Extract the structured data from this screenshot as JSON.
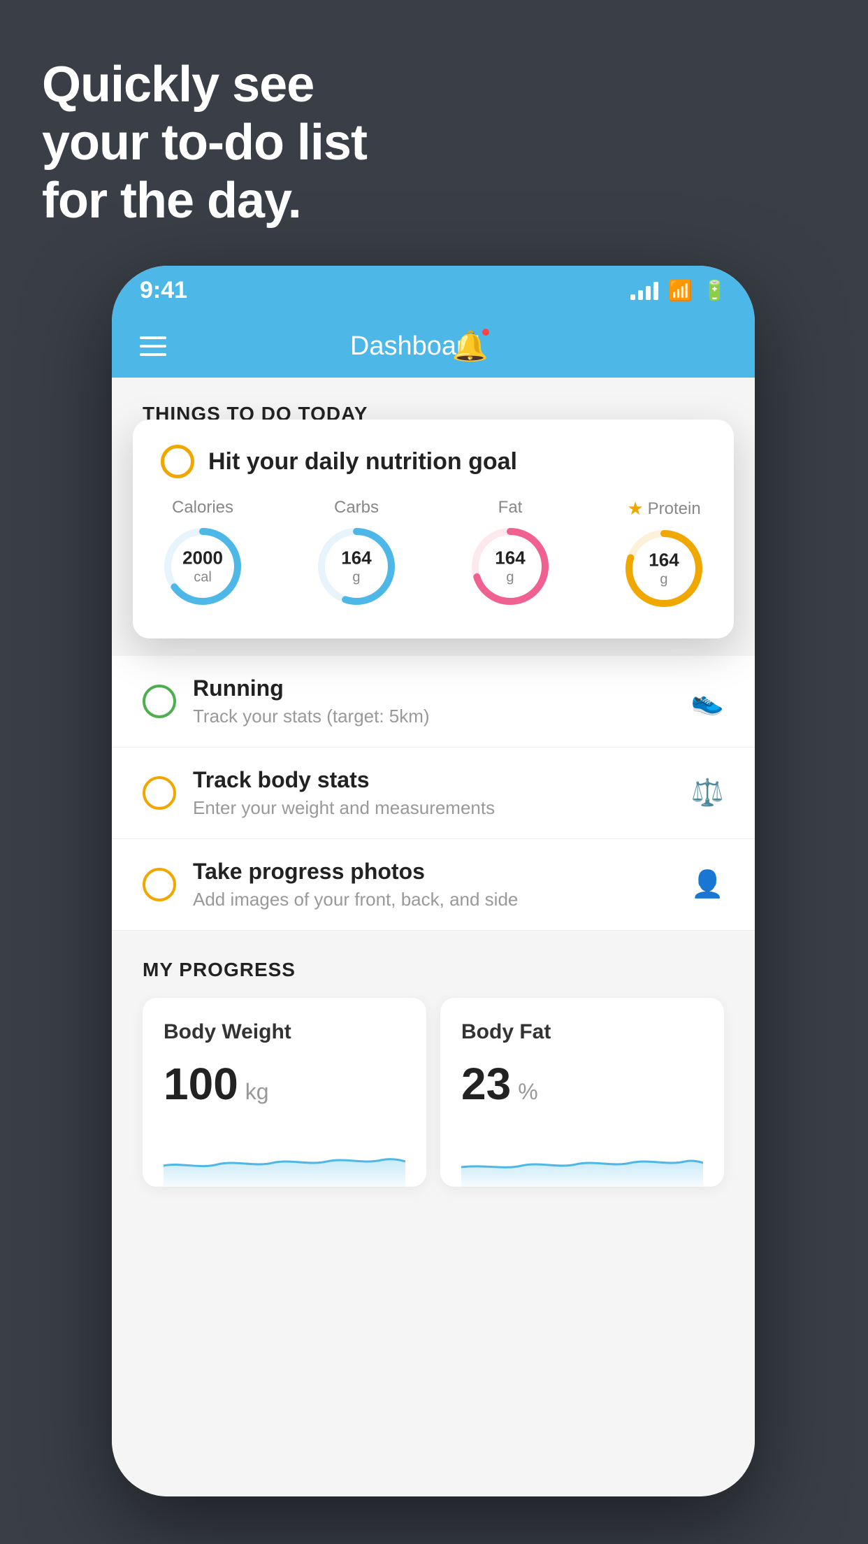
{
  "hero": {
    "line1": "Quickly see",
    "line2": "your to-do list",
    "line3": "for the day."
  },
  "phone": {
    "status_bar": {
      "time": "9:41",
      "signal": "signal",
      "wifi": "wifi",
      "battery": "battery"
    },
    "nav": {
      "title": "Dashboard",
      "hamburger_label": "menu",
      "bell_label": "notifications"
    },
    "things_today": {
      "section_title": "THINGS TO DO TODAY"
    },
    "floating_card": {
      "title": "Hit your daily nutrition goal",
      "nutrients": [
        {
          "label": "Calories",
          "value": "2000",
          "unit": "cal",
          "color": "#4db8e8",
          "percent": 65
        },
        {
          "label": "Carbs",
          "value": "164",
          "unit": "g",
          "color": "#4db8e8",
          "percent": 55
        },
        {
          "label": "Fat",
          "value": "164",
          "unit": "g",
          "color": "#f06090",
          "percent": 70
        },
        {
          "label": "Protein",
          "value": "164",
          "unit": "g",
          "color": "#f0a800",
          "percent": 80,
          "starred": true
        }
      ]
    },
    "todo_items": [
      {
        "name": "Running",
        "desc": "Track your stats (target: 5km)",
        "icon": "👟",
        "circle_color": "green"
      },
      {
        "name": "Track body stats",
        "desc": "Enter your weight and measurements",
        "icon": "⚖️",
        "circle_color": "yellow"
      },
      {
        "name": "Take progress photos",
        "desc": "Add images of your front, back, and side",
        "icon": "👤",
        "circle_color": "yellow"
      }
    ],
    "progress": {
      "title": "MY PROGRESS",
      "cards": [
        {
          "title": "Body Weight",
          "value": "100",
          "unit": "kg"
        },
        {
          "title": "Body Fat",
          "value": "23",
          "unit": "%"
        }
      ]
    }
  }
}
